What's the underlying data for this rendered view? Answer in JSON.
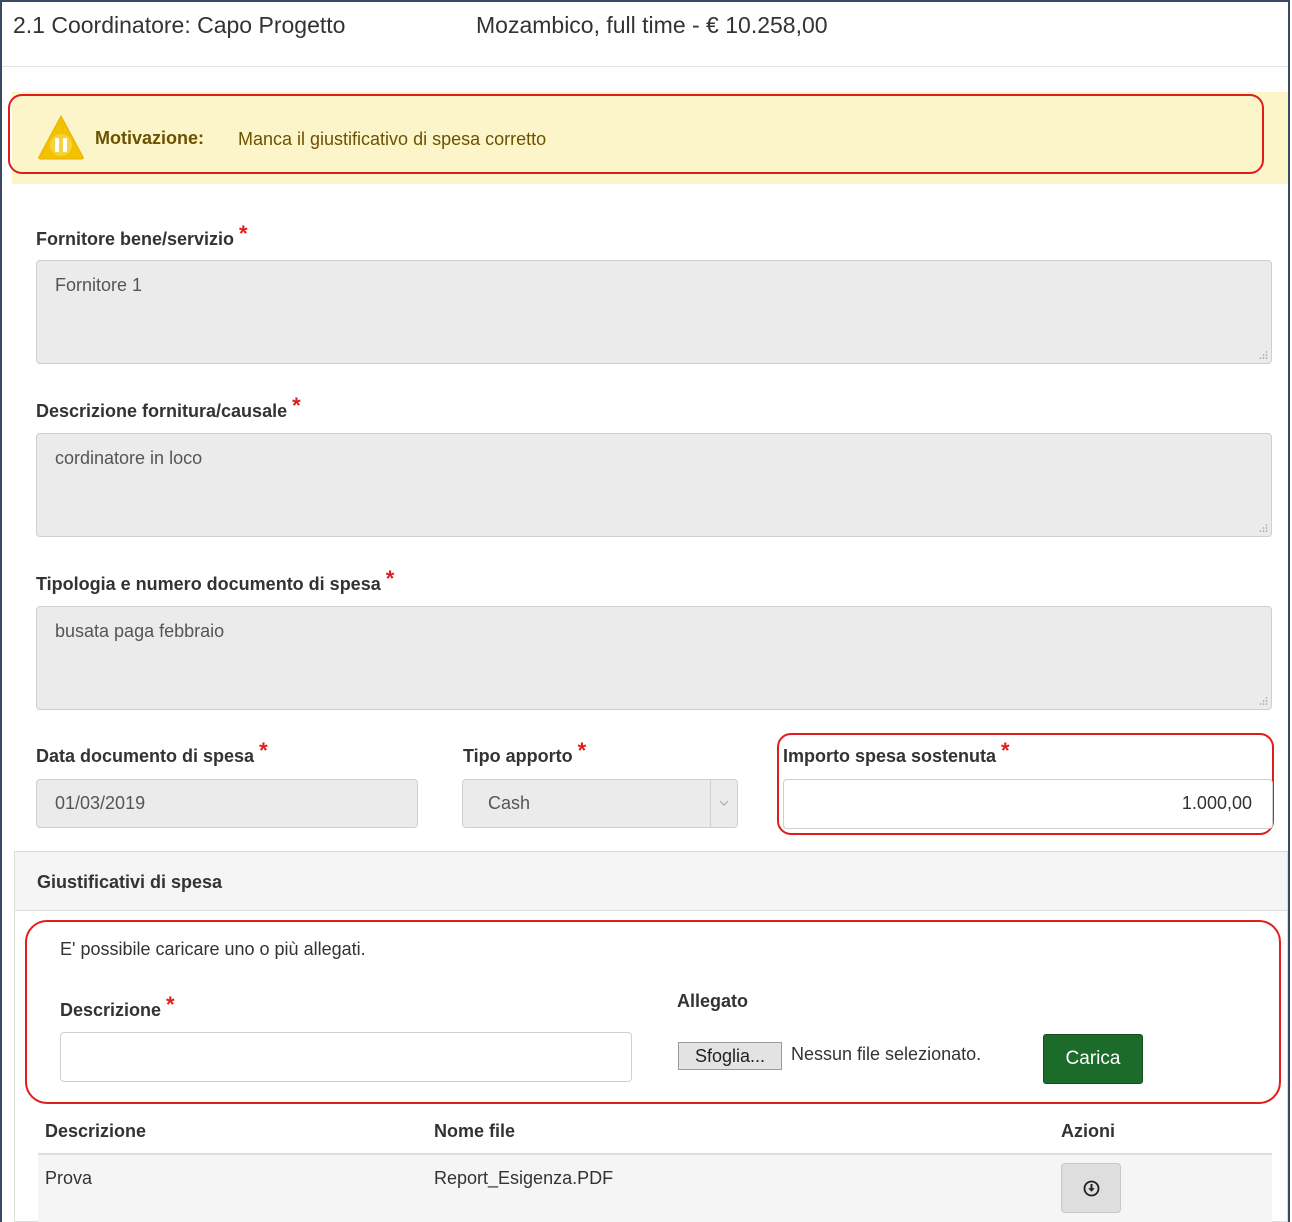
{
  "header": {
    "code_title": "2.1 Coordinatore: Capo Progetto",
    "info": "Mozambico, full time - € 10.258,00"
  },
  "alert": {
    "icon": "warning-pause-icon",
    "label": "Motivazione:",
    "text": "Manca il giustificativo di spesa corretto"
  },
  "form": {
    "supplier": {
      "label": "Fornitore bene/servizio",
      "required": "*",
      "value": "Fornitore 1"
    },
    "description": {
      "label": "Descrizione fornitura/causale",
      "required": "*",
      "value": "cordinatore in loco"
    },
    "doc_type": {
      "label": "Tipologia e numero documento di spesa",
      "required": "*",
      "value": "busata paga febbraio"
    },
    "doc_date": {
      "label": "Data documento di spesa",
      "required": "*",
      "value": "01/03/2019"
    },
    "contribution_type": {
      "label": "Tipo apporto",
      "required": "*",
      "value": "Cash"
    },
    "amount": {
      "label": "Importo spesa sostenuta",
      "required": "*",
      "value": "1.000,00"
    }
  },
  "attachments": {
    "title": "Giustificativi di spesa",
    "hint": "E' possibile caricare uno o più allegati.",
    "desc_label": "Descrizione",
    "desc_required": "*",
    "file_label": "Allegato",
    "browse_label": "Sfoglia...",
    "no_file": "Nessun file selezionato.",
    "upload_label": "Carica",
    "table": {
      "columns": [
        "Descrizione",
        "Nome file",
        "Azioni"
      ],
      "rows": [
        {
          "description": "Prova",
          "file_name": "Report_Esigenza.PDF",
          "action_icon": "download-icon"
        }
      ]
    }
  },
  "colors": {
    "alert_bg": "#fcf5c9",
    "highlight": "#e01d1d",
    "upload_button": "#1d6b2a",
    "required": "#e01d1d"
  }
}
